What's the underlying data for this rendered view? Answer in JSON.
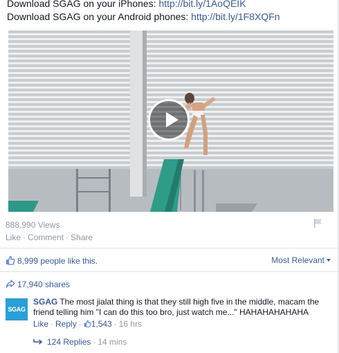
{
  "post": {
    "ios_text": "Download SGAG on your iPhones: ",
    "ios_link": "http://bit.ly/1AoQEIK",
    "android_text": "Download SGAG on your Android phones: ",
    "android_link": "http://bit.ly/1F8XQFn"
  },
  "video": {
    "play_icon": "play-icon"
  },
  "stats": {
    "views": "888,990 Views",
    "actions": [
      "Like",
      "Comment",
      "Share"
    ],
    "flag_icon": "flag-icon"
  },
  "likes": {
    "icon": "thumbs-up-icon",
    "text": "8,999 people like this.",
    "sort_label": "Most Relevant"
  },
  "shares": {
    "icon": "share-arrow-icon",
    "text": "17,940 shares"
  },
  "comment": {
    "avatar_text": "SGAG",
    "author": "SGAG",
    "text": "The most jialat thing is that they still high five in the middle, macam the friend telling him \"I can do this too bro, just watch me...\" HAHAHAHAHAHA",
    "like_label": "Like",
    "reply_label": "Reply",
    "like_count": "1,543",
    "time": "16 hrs"
  },
  "replies": {
    "label": "124 Replies",
    "time": "14 mins"
  },
  "colors": {
    "link": "#3b5998",
    "meta": "#9197a3",
    "avatar_bg": "#2a9fd6"
  }
}
